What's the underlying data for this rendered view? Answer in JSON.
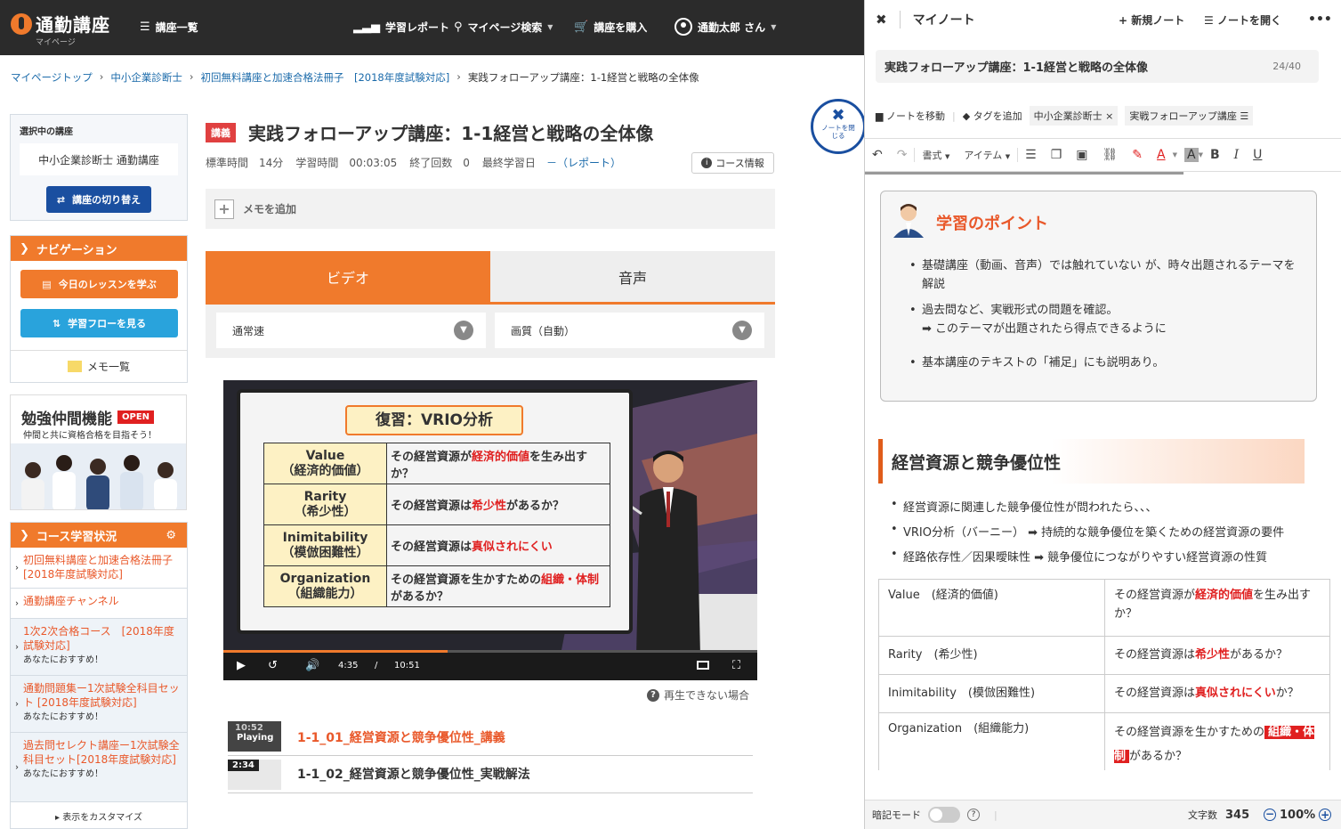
{
  "header": {
    "logo": "通勤講座",
    "logo_sub": "マイページ",
    "course_list": "講座一覧",
    "report": "学習レポート",
    "search": "マイページ検索",
    "buy": "講座を購入",
    "user": "通勤太郎 さん"
  },
  "breadcrumb": [
    "マイページトップ",
    "中小企業診断士",
    "初回無料講座と加速合格法冊子　[2018年度試験対応]",
    "実践フォローアップ講座：1-1経営と戦略の全体像"
  ],
  "sidebar": {
    "selected_label": "選択中の講座",
    "selected_course": "中小企業診断士 通勤講座",
    "switch_btn": "講座の切り替え",
    "nav_head": "ナビゲーション",
    "today_btn": "今日のレッスンを学ぶ",
    "flow_btn": "学習フローを見る",
    "memo_list": "メモ一覧",
    "study_title": "勉強仲間機能",
    "study_open": "OPEN",
    "study_sub": "仲間と共に資格合格を目指そう！",
    "status_head": "コース学習状況",
    "status_items": [
      {
        "title": "初回無料講座と加速合格法冊子　[2018年度試験対応]",
        "sub": ""
      },
      {
        "title": "通勤講座チャンネル",
        "sub": ""
      },
      {
        "title": "1次2次合格コース　[2018年度試験対応]",
        "sub": "あなたにおすすめ！"
      },
      {
        "title": "通勤問題集ー1次試験全科目セット [2018年度試験対応]",
        "sub": "あなたにおすすめ！"
      },
      {
        "title": "過去問セレクト講座ー1次試験全科目セット[2018年度試験対応]",
        "sub": "あなたにおすすめ！"
      }
    ],
    "customize": "表示をカスタマイズ"
  },
  "close_note": "ノートを閉じる",
  "main": {
    "badge": "講義",
    "title": "実践フォローアップ講座：1-1経営と戦略の全体像",
    "meta": {
      "std_time_label": "標準時間",
      "std_time": "14分",
      "study_time_label": "学習時間",
      "study_time": "00:03:05",
      "done_label": "終了回数",
      "done": "0",
      "last_label": "最終学習日",
      "last": "－（レポート）"
    },
    "course_info": "コース情報",
    "memo_add": "メモを追加",
    "tabs": [
      "ビデオ",
      "音声"
    ],
    "speed": "通常速",
    "quality": "画質（自動）",
    "video": {
      "board_title": "復習：VRIO分析",
      "rows": [
        {
          "k": "Value",
          "k2": "（経済的価値）",
          "pre": "その経営資源が",
          "hl": "経済的価値",
          "post": "を生み出すか？"
        },
        {
          "k": "Rarity",
          "k2": "（希少性）",
          "pre": "その経営資源は",
          "hl": "希少性",
          "post": "があるか？"
        },
        {
          "k": "Inimitability",
          "k2": "（模倣困難性）",
          "pre": "その経営資源は",
          "hl": "真似されにくい",
          "post": ""
        },
        {
          "k": "Organization",
          "k2": "（組織能力）",
          "pre": "その経営資源を生かすための",
          "hl": "組織・体制",
          "post": "があるか？"
        }
      ],
      "current": "4:35",
      "sep": "/",
      "total": "10:51",
      "progress": 0.42
    },
    "cant_play": "再生できない場合",
    "playlist": [
      {
        "thumb": "10:52",
        "status": "Playing",
        "title": "1-1_01_経営資源と競争優位性_講義"
      },
      {
        "thumb": "2:34",
        "status": "",
        "title": "1-1_02_経営資源と競争優位性_実戦解法"
      }
    ]
  },
  "note": {
    "header": "マイノート",
    "new": "新規ノート",
    "open": "ノートを開く",
    "title": "実践フォローアップ講座：1-1経営と戦略の全体像",
    "count": "24/40",
    "move": "ノートを移動",
    "tag_add": "タグを追加",
    "tags": [
      "中小企業診断士",
      "実戦フォローアップ講座"
    ],
    "fmt": "書式",
    "item": "アイテム",
    "point_title": "学習のポイント",
    "points": [
      "基礎講座（動画、音声）では触れていない が、時々出題されるテーマを解説",
      "過去問など、実戦形式の問題を確認。\n➡ このテーマが出題されたら得点できるように",
      "基本講座のテキストの「補足」にも説明あり。"
    ],
    "section": "経営資源と競争優位性",
    "bullets": [
      "経営資源に関連した競争優位性が問われたら、、、",
      "VRIO分析（バーニー） ➡ 持続的な競争優位を築くための経営資源の要件",
      "経路依存性／因果曖昧性 ➡ 競争優位につながりやすい経営資源の性質"
    ],
    "table": [
      {
        "k": "Value　(経済的価値)",
        "pre": "その経営資源が",
        "hl": "経済的価値",
        "post": "を生み出すか？"
      },
      {
        "k": "Rarity　(希少性)",
        "pre": "その経営資源は",
        "hl": "希少性",
        "post": "があるか？"
      },
      {
        "k": "Inimitability　(模倣困難性)",
        "pre": "その経営資源は",
        "hl": "真似されにくい",
        "post": "か？"
      },
      {
        "k": "Organization　(組織能力)",
        "pre": "その経営資源を生かすための",
        "hl": "組織・体制",
        "post": "があるか？"
      }
    ],
    "footer": {
      "memorize": "暗記モード",
      "chars_label": "文字数",
      "chars": "345",
      "zoom": "100%"
    }
  }
}
